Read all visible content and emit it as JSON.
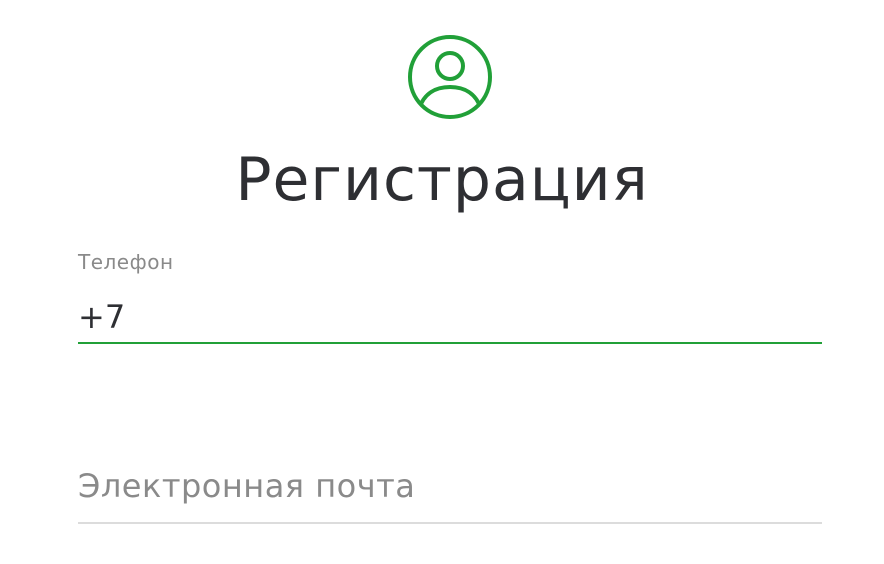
{
  "colors": {
    "accent": "#21a038",
    "title": "#2e2f33",
    "label": "#8a8a8a",
    "divider": "#dcdcdc"
  },
  "header": {
    "icon": "user-circle-icon",
    "title": "Регистрация"
  },
  "form": {
    "phone": {
      "label": "Телефон",
      "value": "+7"
    },
    "email": {
      "placeholder": "Электронная почта",
      "value": ""
    }
  }
}
